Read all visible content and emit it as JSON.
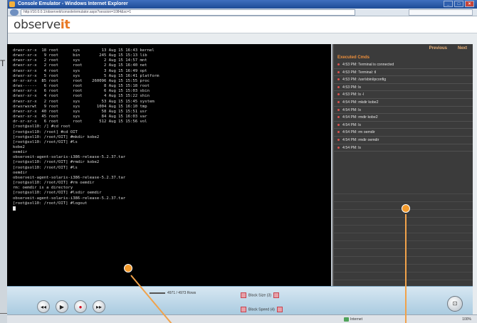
{
  "window": {
    "title": "Console Emulator - Windows Internet Explorer",
    "url": "http://10.0.0.1/observeit/console/emulator.aspx?session=1084&sc=1"
  },
  "app": {
    "logo_main": "observe",
    "logo_accent": "it"
  },
  "console": {
    "lines": [
      "drwxr-xr-x  18 root      sys         13 Aug 15 16:43 kernel",
      "drwxr-xr-x   9 root      bin        245 Aug 15 15:13 lib",
      "drwxr-xr-x   2 root      sys          2 Aug 15 14:57 mnt",
      "drwxr-xr-x   2 root      root         2 Aug 15 16:40 net",
      "drwxr-xr-x   4 root      sys          3 Aug 15 16:49 opt",
      "drwxr-xr-x   5 root      sys          5 Aug 15 16:41 platform",
      "dr-xr-xr-x  85 root      root    260096 Aug 15 15:55 proc",
      "drwx------   6 root      root         8 Aug 15 15:18 root",
      "drwxr-xr-x   6 root      root         6 Aug 15 15:03 sbin",
      "drwxr-xr-x   4 root      root         4 Aug 15 15:22 shin",
      "drwxr-xr-x   2 root      sys         53 Aug 15 15:45 system",
      "drwxrwxrwt   9 root      sys       1004 Aug 15 16:10 tmp",
      "drwxr-xr-x  40 root      sys         58 Aug 15 15:51 usr",
      "drwxr-xr-x  45 root      sys         84 Aug 15 16:03 var",
      "dr-xr-xr-x   6 root      root       512 Aug 15 15:56 vol",
      "[root@sol10: /] #cd root",
      "[root@sol10: /root] #cd OIT",
      "[root@sol10: /root/OIT] #mkdir kobe2",
      "[root@sol10: /root/OIT] #ls",
      "kobe2",
      "oemdir",
      "observeit-agent-solaris-i386-release-5.2.37.tar",
      "[root@sol10: /root/OIT] #rmdir kobe2",
      "[root@sol10: /root/OIT] #ls",
      "oemdir",
      "observeit-agent-solaris-i386-release-5.2.37.tar",
      "[root@sol10: /root/OIT] #rm oemdir",
      "rm: oemdir is a directory",
      "[root@sol10: /root/OIT] #lsdir oemdir",
      "observeit-agent-solaris-i386-release-5.2.37.tar",
      "[root@sol10: /root/OIT] #logout"
    ]
  },
  "panel": {
    "prev_label": "Previous",
    "next_label": "Next",
    "title": "Executed Cmds",
    "events": [
      "4:53 PM: Terminal is connected",
      "4:53 PM: Terminal: tl",
      "4:53 PM: /usr/sbin/ipconfig",
      "4:53 PM: ls",
      "4:53 PM: ls -l",
      "4:54 PM: mkdir kobe2",
      "4:54 PM: ls",
      "4:54 PM: rmdir kobe2",
      "4:54 PM: ls",
      "4:54 PM: rm oemdir",
      "4:54 PM: rmdir oemdir",
      "4:54 PM: ls"
    ]
  },
  "controls": {
    "scrub_label": "4971 / 4973 Rows",
    "block_size": "Block Size (3)",
    "block_speed": "Block Speed (4)"
  },
  "status": {
    "zone": "Internet",
    "zoom": "100%"
  },
  "background": {
    "left_letter": "T"
  },
  "colors": {
    "accent": "#f39a2c",
    "console_bg": "#000000",
    "panel_bg": "#3b3b3b"
  },
  "icons": {
    "rewind": "rewind-icon",
    "play": "play-icon",
    "record": "record-icon",
    "forward": "forward-icon",
    "exit": "exit-icon"
  }
}
